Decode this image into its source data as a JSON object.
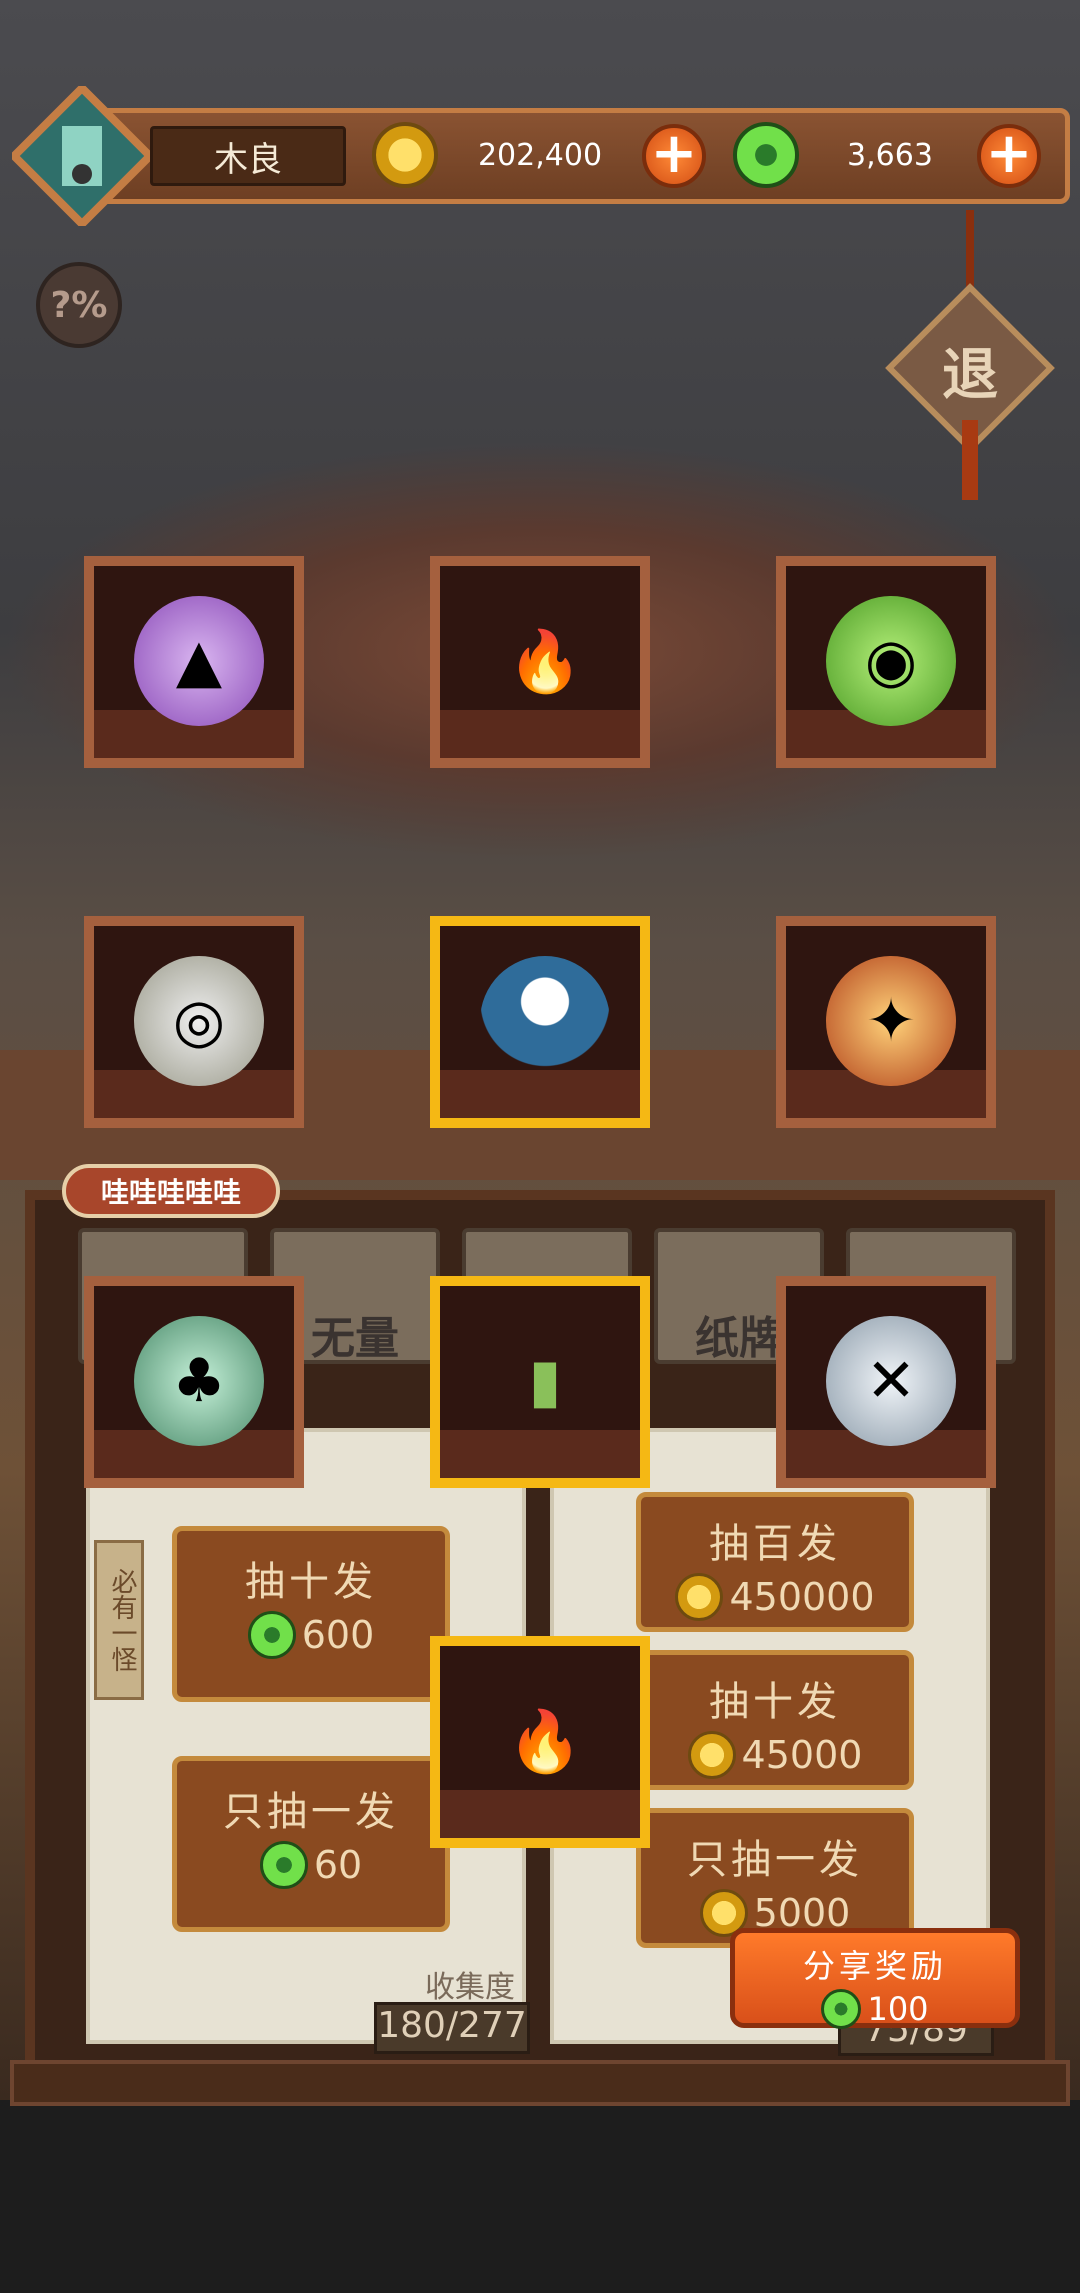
{
  "header": {
    "player_name": "木良",
    "gold_amount": "202,400",
    "jade_amount": "3,663",
    "help_label": "?%",
    "exit_label": "退"
  },
  "grid": [
    {
      "item": "purple-orb",
      "selected": false
    },
    {
      "item": "blue-flame",
      "selected": false
    },
    {
      "item": "green-slime-orb",
      "selected": false
    },
    {
      "item": "white-vortex-orb",
      "selected": false
    },
    {
      "item": "ghost-in-cup",
      "selected": true
    },
    {
      "item": "fire-orb",
      "selected": false
    },
    {
      "item": "jade-pendant-orb",
      "selected": false
    },
    {
      "item": "talisman-pouch",
      "selected": true
    },
    {
      "item": "sword-orb",
      "selected": false
    },
    {
      "item": "blue-flame",
      "selected": true
    }
  ],
  "bubble_text": "哇哇哇哇哇",
  "tabs": [
    "",
    "无量",
    "",
    "纸牌",
    ""
  ],
  "side_tag": "必有一怪",
  "left_buttons": [
    {
      "label": "抽十发",
      "price": "600"
    },
    {
      "label": "只抽一发",
      "price": "60"
    }
  ],
  "right_buttons": [
    {
      "label": "抽百发",
      "price": "450000"
    },
    {
      "label": "抽十发",
      "price": "45000"
    },
    {
      "label": "只抽一发",
      "price": "5000"
    }
  ],
  "collection": {
    "label": "收集度",
    "value": "180/277"
  },
  "right_count": "75/89",
  "share": {
    "label": "分享奖励",
    "reward": "100"
  },
  "colors": {
    "accent": "#f5b814",
    "frame": "#a5603e",
    "button": "#8a4a20"
  }
}
